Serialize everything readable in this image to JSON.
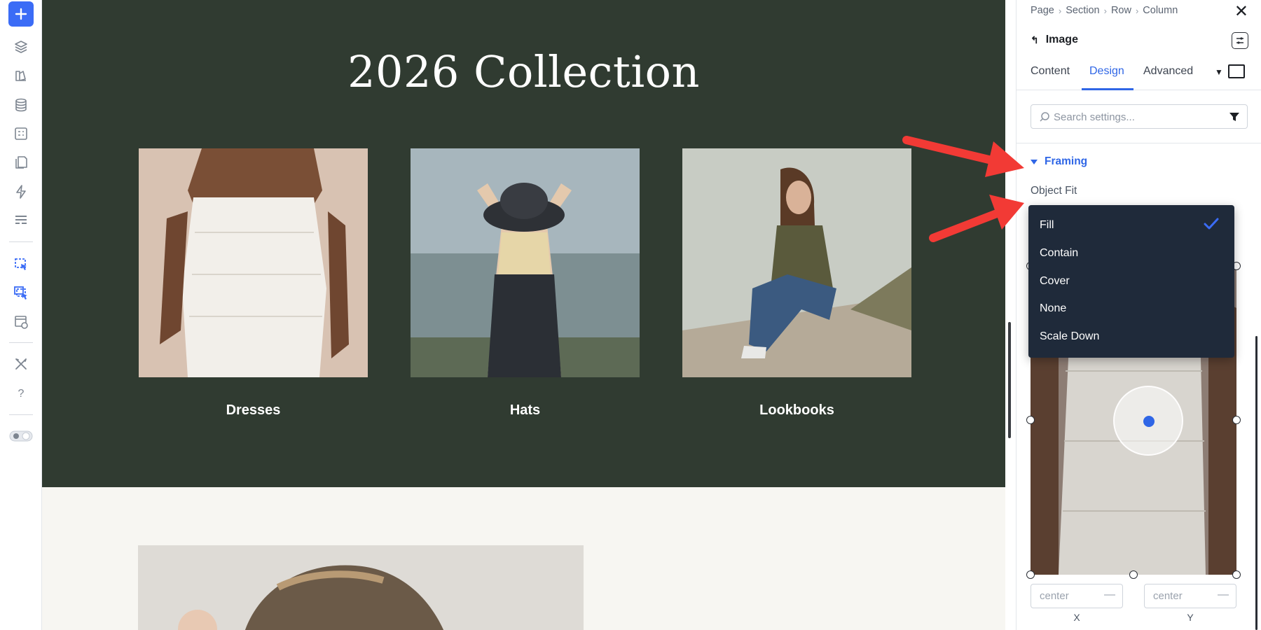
{
  "canvas": {
    "hero_title": "2026 Collection",
    "cards": [
      {
        "label": "Dresses"
      },
      {
        "label": "Hats"
      },
      {
        "label": "Lookbooks"
      }
    ]
  },
  "panel": {
    "breadcrumb": [
      "Page",
      "Section",
      "Row",
      "Column"
    ],
    "element_title": "Image",
    "tabs": [
      "Content",
      "Design",
      "Advanced"
    ],
    "active_tab": "Design",
    "search": {
      "placeholder": "Search settings..."
    },
    "section_title": "Framing",
    "object_fit_label": "Object Fit",
    "object_fit_selected": "Fill",
    "position_x": {
      "placeholder": "center",
      "caption": "X"
    },
    "position_y": {
      "placeholder": "center",
      "caption": "Y"
    }
  },
  "dropdown": {
    "options": [
      "Fill",
      "Contain",
      "Cover",
      "None",
      "Scale Down"
    ],
    "selected": "Fill"
  },
  "colors": {
    "accent": "#2f66e6",
    "hero_bg": "#303b31",
    "dropdown_bg": "#1f2a3a",
    "annotation_arrow": "#f23a35"
  },
  "icons": {
    "left_bar": [
      "plus-icon",
      "layers-icon",
      "palette-icon",
      "database-icon",
      "form-icon",
      "pages-icon",
      "lightning-icon",
      "layout-icon",
      "select-element-icon",
      "multi-select-icon",
      "preview-icon",
      "tools-icon",
      "help-icon",
      "theme-toggle-icon"
    ]
  }
}
